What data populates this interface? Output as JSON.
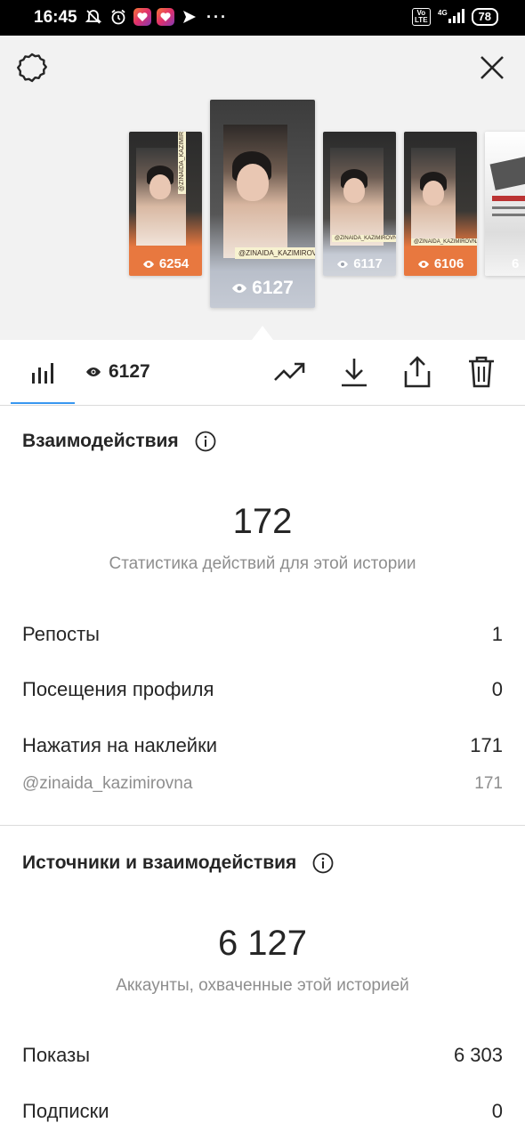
{
  "status_bar": {
    "time": "16:45",
    "volte": "Vo\nLTE",
    "network": "4G",
    "battery": "78"
  },
  "preview": {
    "thumbnails": [
      {
        "views": "6254",
        "sticker": "@ZINAIDA_KAZIMIROVNA"
      },
      {
        "views": "6127",
        "sticker": "@ZINAIDA_KAZIMIROVNA"
      },
      {
        "views": "6117",
        "sticker": "@ZINAIDA_KAZIMIROVNA"
      },
      {
        "views": "6106",
        "sticker": "@ZINAIDA_KAZIMIROVNA"
      },
      {
        "views": "6",
        "sticker": ""
      }
    ]
  },
  "toolbar": {
    "view_count": "6127"
  },
  "interactions": {
    "title": "Взаимодействия",
    "total": "172",
    "subtitle": "Статистика действий для этой истории",
    "rows": [
      {
        "label": "Репосты",
        "value": "1"
      },
      {
        "label": "Посещения профиля",
        "value": "0"
      },
      {
        "label": "Нажатия на наклейки",
        "value": "171"
      }
    ],
    "sticker_row": {
      "label": "@zinaida_kazimirovna",
      "value": "171"
    }
  },
  "discovery": {
    "title": "Источники и взаимодействия",
    "total": "6 127",
    "subtitle": "Аккаунты, охваченные этой историей",
    "rows": [
      {
        "label": "Показы",
        "value": "6 303"
      },
      {
        "label": "Подписки",
        "value": "0"
      }
    ]
  },
  "icons": {
    "settings": "gear-icon",
    "close": "close-icon",
    "insights": "bar-chart-icon",
    "eye": "eye-icon",
    "promote": "trend-up-icon",
    "download": "download-icon",
    "share": "share-icon",
    "delete": "trash-icon",
    "info": "info-icon"
  },
  "colors": {
    "accent": "#3897f0",
    "orange_overlay": "#e8783f"
  }
}
